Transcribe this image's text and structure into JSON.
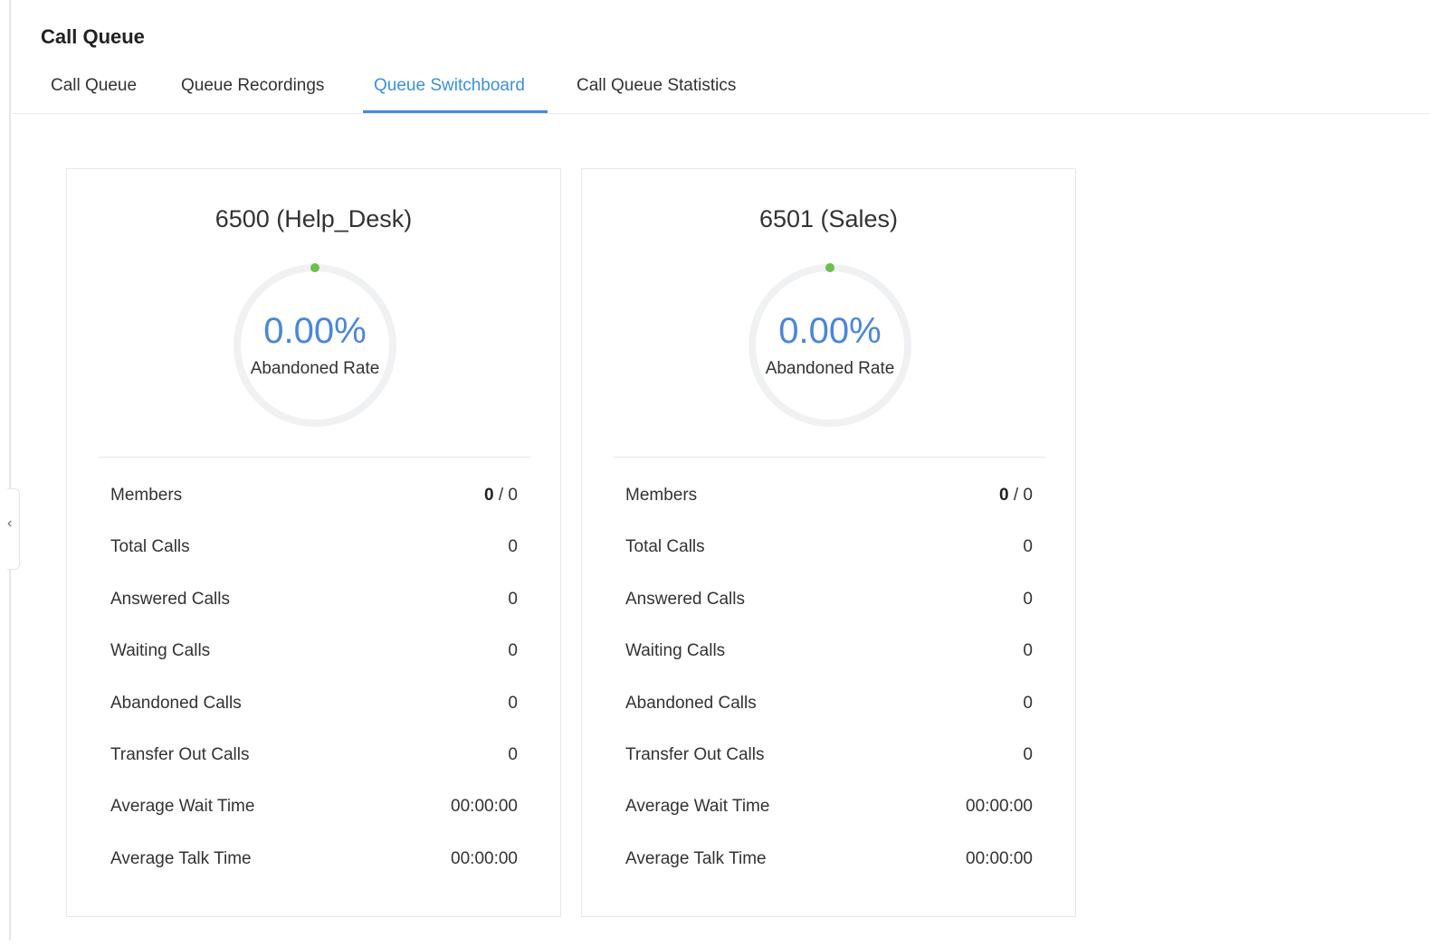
{
  "page": {
    "title": "Call Queue"
  },
  "tabs": [
    {
      "label": "Call Queue",
      "active": false
    },
    {
      "label": "Queue Recordings",
      "active": false
    },
    {
      "label": "Queue Switchboard",
      "active": true
    },
    {
      "label": "Call Queue Statistics",
      "active": false
    }
  ],
  "sidebar": {
    "collapse_glyph": "‹"
  },
  "colors": {
    "accent": "#3d8fdc",
    "gauge_value": "#4a86dc",
    "gauge_track": "#f0f1f3",
    "gauge_indicator": "#6cc04a"
  },
  "queues": [
    {
      "title": "6500 (Help_Desk)",
      "abandoned_rate": "0.00%",
      "abandoned_rate_fraction": 0.0,
      "abandoned_rate_label": "Abandoned Rate",
      "members_online": "0",
      "members_sep": " / ",
      "members_total": "0",
      "stats": [
        {
          "label": "Members"
        },
        {
          "label": "Total Calls",
          "value": "0"
        },
        {
          "label": "Answered Calls",
          "value": "0"
        },
        {
          "label": "Waiting Calls",
          "value": "0"
        },
        {
          "label": "Abandoned Calls",
          "value": "0"
        },
        {
          "label": "Transfer Out Calls",
          "value": "0"
        },
        {
          "label": "Average Wait Time",
          "value": "00:00:00"
        },
        {
          "label": "Average Talk Time",
          "value": "00:00:00"
        }
      ]
    },
    {
      "title": "6501 (Sales)",
      "abandoned_rate": "0.00%",
      "abandoned_rate_fraction": 0.0,
      "abandoned_rate_label": "Abandoned Rate",
      "members_online": "0",
      "members_sep": " / ",
      "members_total": "0",
      "stats": [
        {
          "label": "Members"
        },
        {
          "label": "Total Calls",
          "value": "0"
        },
        {
          "label": "Answered Calls",
          "value": "0"
        },
        {
          "label": "Waiting Calls",
          "value": "0"
        },
        {
          "label": "Abandoned Calls",
          "value": "0"
        },
        {
          "label": "Transfer Out Calls",
          "value": "0"
        },
        {
          "label": "Average Wait Time",
          "value": "00:00:00"
        },
        {
          "label": "Average Talk Time",
          "value": "00:00:00"
        }
      ]
    }
  ]
}
